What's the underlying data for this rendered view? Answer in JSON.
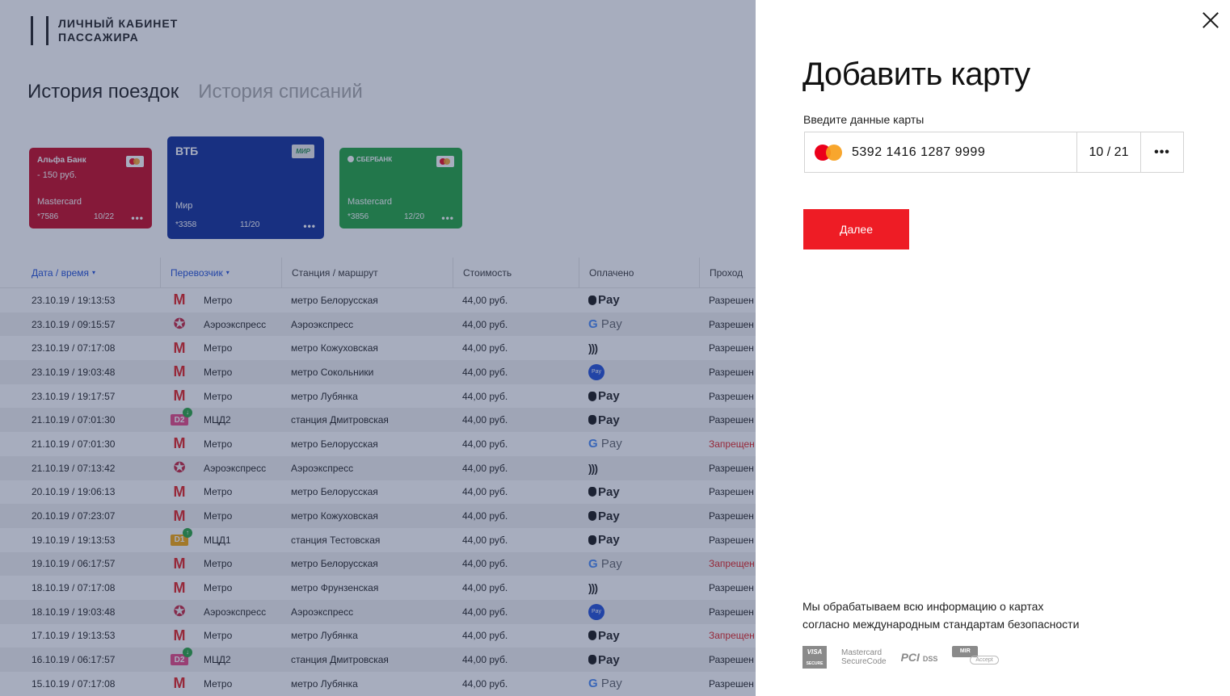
{
  "header": {
    "logo_line1": "Личный кабинет",
    "logo_line2": "пассажира",
    "tabs": [
      {
        "label": "История поездок",
        "active": true
      },
      {
        "label": "История списаний",
        "active": false
      }
    ]
  },
  "cards": {
    "alfa": {
      "bank": "Альфа Банк",
      "amount": "- 150 руб.",
      "type": "Mastercard",
      "number": "*7586",
      "expiry": "10/22",
      "more": "•••"
    },
    "vtb": {
      "bank": "ВТБ",
      "system": "МИР",
      "type": "Мир",
      "number": "*3358",
      "expiry": "11/20",
      "more": "•••"
    },
    "sber": {
      "bank": "СБЕРБАНК",
      "type": "Mastercard",
      "number": "*3856",
      "expiry": "12/20",
      "more": "•••"
    }
  },
  "table": {
    "headers": {
      "date": "Дата / время",
      "carrier": "Перевозчик",
      "station": "Станция / маршрут",
      "cost": "Стоимость",
      "paid": "Оплачено",
      "pass": "Проход"
    },
    "rows": [
      {
        "date": "23.10.19 / 19:13:53",
        "icon": "metro",
        "carrier": "Метро",
        "station": "метро Белорусская",
        "cost": "44,00 руб.",
        "pay": "apple",
        "pass": "Разрешен",
        "ok": true
      },
      {
        "date": "23.10.19 / 09:15:57",
        "icon": "aero",
        "carrier": "Аэроэкспресс",
        "station": "Аэроэкспресс",
        "cost": "44,00 руб.",
        "pay": "google",
        "pass": "Разрешен",
        "ok": true
      },
      {
        "date": "23.10.19 / 07:17:08",
        "icon": "metro",
        "carrier": "Метро",
        "station": "метро Кожуховская",
        "cost": "44,00 руб.",
        "pay": "contactless",
        "pass": "Разрешен",
        "ok": true
      },
      {
        "date": "23.10.19 / 19:03:48",
        "icon": "metro",
        "carrier": "Метро",
        "station": "метро Сокольники",
        "cost": "44,00 руб.",
        "pay": "samsung",
        "pass": "Разрешен",
        "ok": true
      },
      {
        "date": "23.10.19 / 19:17:57",
        "icon": "metro",
        "carrier": "Метро",
        "station": "метро Лубянка",
        "cost": "44,00 руб.",
        "pay": "apple",
        "pass": "Разрешен",
        "ok": true
      },
      {
        "date": "21.10.19 / 07:01:30",
        "icon": "d2",
        "carrier": "МЦД2",
        "station": "станция Дмитровская",
        "cost": "44,00 руб.",
        "pay": "apple",
        "pass": "Разрешен",
        "ok": true
      },
      {
        "date": "21.10.19 / 07:01:30",
        "icon": "metro",
        "carrier": "Метро",
        "station": "метро Белорусская",
        "cost": "44,00 руб.",
        "pay": "google",
        "pass": "Запрещен",
        "ok": false
      },
      {
        "date": "21.10.19 / 07:13:42",
        "icon": "aero",
        "carrier": "Аэроэкспресс",
        "station": "Аэроэкспресс",
        "cost": "44,00 руб.",
        "pay": "contactless",
        "pass": "Разрешен",
        "ok": true
      },
      {
        "date": "20.10.19 / 19:06:13",
        "icon": "metro",
        "carrier": "Метро",
        "station": "метро Белорусская",
        "cost": "44,00 руб.",
        "pay": "apple",
        "pass": "Разрешен",
        "ok": true
      },
      {
        "date": "20.10.19 / 07:23:07",
        "icon": "metro",
        "carrier": "Метро",
        "station": "метро Кожуховская",
        "cost": "44,00 руб.",
        "pay": "apple",
        "pass": "Разрешен",
        "ok": true
      },
      {
        "date": "19.10.19 / 19:13:53",
        "icon": "d1",
        "carrier": "МЦД1",
        "station": "станция Тестовская",
        "cost": "44,00 руб.",
        "pay": "apple",
        "pass": "Разрешен",
        "ok": true
      },
      {
        "date": "19.10.19 / 06:17:57",
        "icon": "metro",
        "carrier": "Метро",
        "station": "метро Белорусская",
        "cost": "44,00 руб.",
        "pay": "google",
        "pass": "Запрещен",
        "ok": false
      },
      {
        "date": "18.10.19 / 07:17:08",
        "icon": "metro",
        "carrier": "Метро",
        "station": "метро Фрунзенская",
        "cost": "44,00 руб.",
        "pay": "contactless",
        "pass": "Разрешен",
        "ok": true
      },
      {
        "date": "18.10.19 / 19:03:48",
        "icon": "aero",
        "carrier": "Аэроэкспресс",
        "station": "Аэроэкспресс",
        "cost": "44,00 руб.",
        "pay": "samsung",
        "pass": "Разрешен",
        "ok": true
      },
      {
        "date": "17.10.19 / 19:13:53",
        "icon": "metro",
        "carrier": "Метро",
        "station": "метро Лубянка",
        "cost": "44,00 руб.",
        "pay": "apple",
        "pass": "Запрещен",
        "ok": false
      },
      {
        "date": "16.10.19 / 06:17:57",
        "icon": "d2",
        "carrier": "МЦД2",
        "station": "станция Дмитровская",
        "cost": "44,00 руб.",
        "pay": "apple",
        "pass": "Разрешен",
        "ok": true
      },
      {
        "date": "15.10.19 / 07:17:08",
        "icon": "metro",
        "carrier": "Метро",
        "station": "метро Лубянка",
        "cost": "44,00 руб.",
        "pay": "google",
        "pass": "Разрешен",
        "ok": true
      }
    ]
  },
  "icon_glyphs": {
    "metro": "M",
    "aero": "✪",
    "d1": "D1",
    "d2": "D2",
    "arrow_up": "↑",
    "arrow_down": "↓",
    "apple": "Pay",
    "google_g": "G",
    "google": "Pay",
    "contactless": ")))",
    "samsung": "Pay"
  },
  "panel": {
    "title": "Добавить карту",
    "field_label": "Введите данные карты",
    "card_number": "5392 1416 1287 9999",
    "card_expiry": "10 / 21",
    "more_label": "•••",
    "next_label": "Далее",
    "security_line1": "Мы обрабатываем всю информацию о картах",
    "security_line2": "согласно международным стандартам безопасности",
    "logos": {
      "visa_top": "VISA",
      "visa_bottom": "SECURE",
      "mc_line1": "Mastercard",
      "mc_line2": "SecureCode",
      "pci": "PCI",
      "pci_dss": "DSS",
      "mir_top": "MIR",
      "mir_accept": "Accept"
    }
  },
  "colors": {
    "accent_red": "#ee1c25",
    "link_blue": "#1a4bd6",
    "denied_red": "#e21a1a",
    "alfa_red": "#c4001a",
    "vtb_blue": "#0a2896",
    "sber_green": "#1aa23a"
  }
}
